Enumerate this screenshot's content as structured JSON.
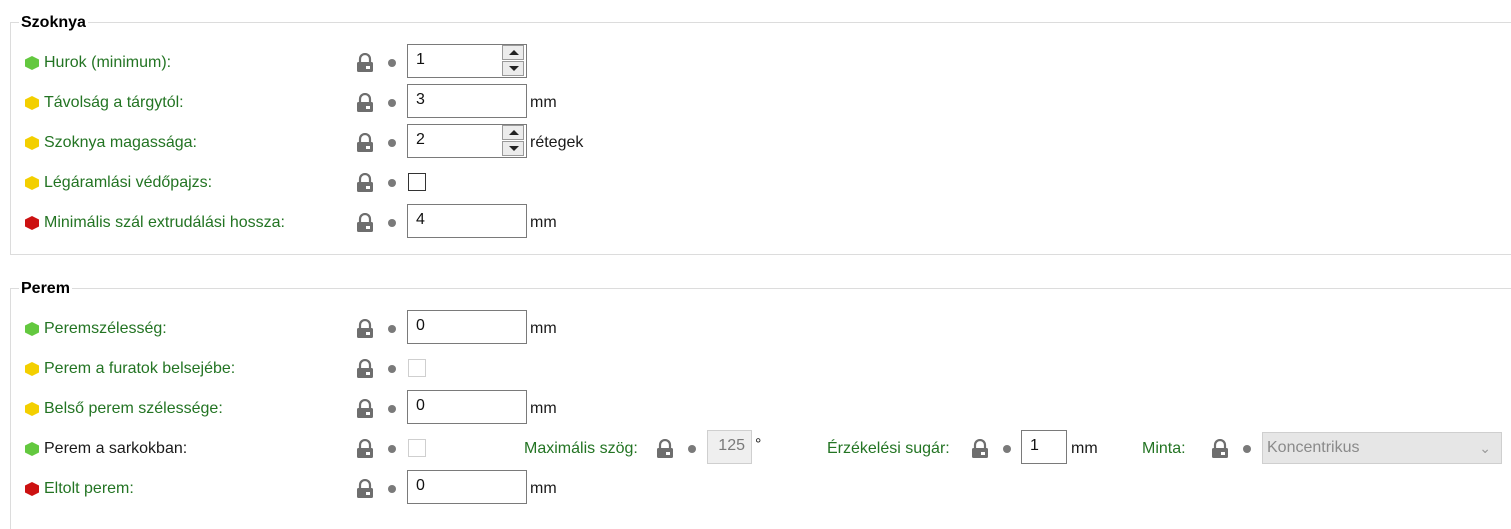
{
  "skirt": {
    "title": "Szoknya",
    "loops_label": "Hurok (minimum):",
    "loops_value": "1",
    "distance_label": "Távolság a tárgytól:",
    "distance_value": "3",
    "distance_unit": "mm",
    "height_label": "Szoknya magassága:",
    "height_value": "2",
    "height_unit": "rétegek",
    "draft_shield_label": "Légáramlási védőpajzs:",
    "min_extrusion_label": "Minimális szál extrudálási hossza:",
    "min_extrusion_value": "4",
    "min_extrusion_unit": "mm"
  },
  "brim": {
    "title": "Perem",
    "width_label": "Peremszélesség:",
    "width_value": "0",
    "width_unit": "mm",
    "inside_holes_label": "Perem a furatok belsejébe:",
    "inner_width_label": "Belső perem szélessége:",
    "inner_width_value": "0",
    "inner_width_unit": "mm",
    "ears_label": "Perem a sarkokban:",
    "max_angle_label": "Maximális szög:",
    "max_angle_value": "125",
    "max_angle_unit": "°",
    "detection_radius_label": "Érzékelési sugár:",
    "detection_radius_value": "1",
    "detection_radius_unit": "mm",
    "pattern_label": "Minta:",
    "pattern_value": "Koncentrikus",
    "offset_label": "Eltolt perem:",
    "offset_value": "0",
    "offset_unit": "mm"
  },
  "colors": {
    "label_green": "#237423",
    "simple": "#63c83f",
    "advanced": "#f3cf00",
    "expert": "#cc1111"
  },
  "icons": {
    "lock": "lock-icon",
    "dot": "dot-icon",
    "spin": "spin-buttons"
  }
}
